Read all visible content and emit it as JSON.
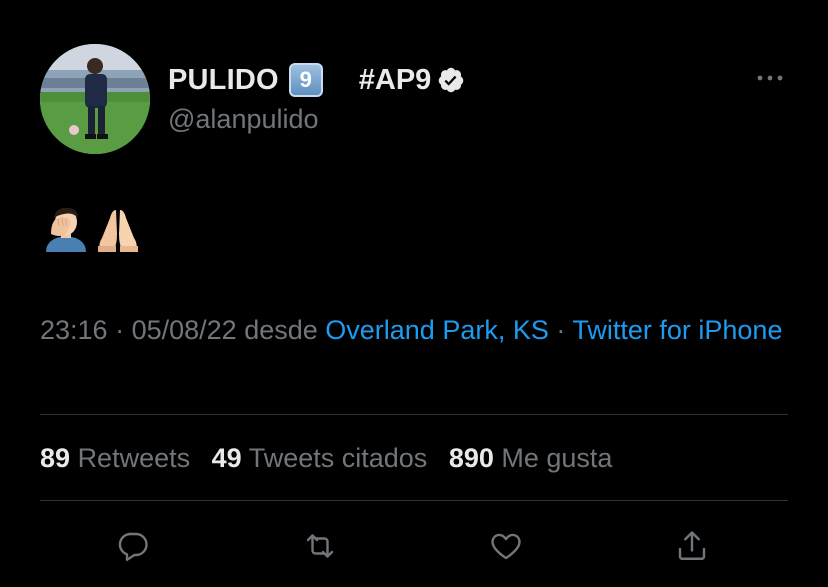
{
  "tweet": {
    "display_name": "PULIDO",
    "keycap_digit": "9",
    "hashtag": "#AP9",
    "handle": "@alanpulido",
    "body_emojis": [
      "facepalm-emoji",
      "folded-hands-emoji"
    ],
    "time": "23:16",
    "sep1": " · ",
    "date": "05/08/22",
    "desde": " desde ",
    "location": "Overland Park, KS",
    "sep2": " · ",
    "source": "Twitter for iPhone"
  },
  "stats": {
    "retweets_count": "89",
    "retweets_label": "Retweets",
    "quotes_count": "49",
    "quotes_label": "Tweets citados",
    "likes_count": "890",
    "likes_label": "Me gusta"
  },
  "actions": [
    "reply-icon",
    "retweet-icon",
    "like-icon",
    "share-icon"
  ],
  "colors": {
    "background": "#000000",
    "primary_text": "#e7e9ea",
    "secondary_text": "#71767b",
    "link": "#1d9bf0",
    "divider": "#2f3336"
  }
}
